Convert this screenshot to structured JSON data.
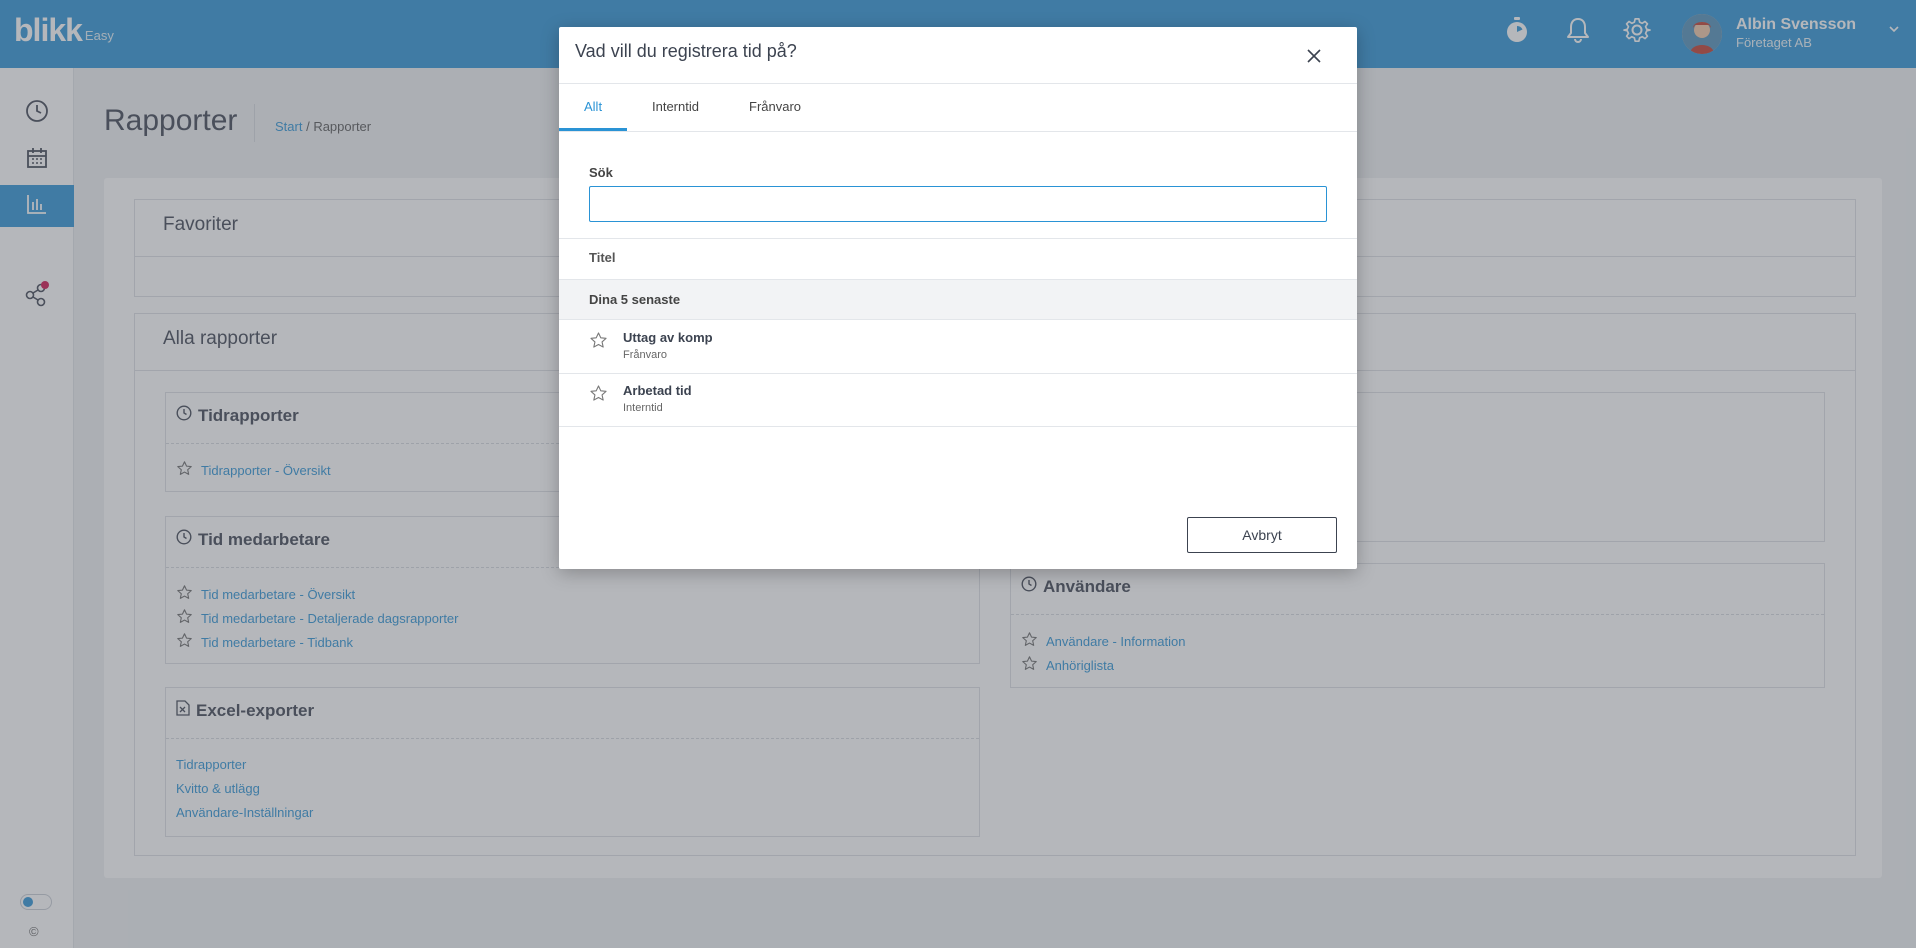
{
  "header": {
    "logo_brand": "blikk",
    "logo_edition": "Easy",
    "user_name": "Albin Svensson",
    "user_company": "Företaget AB"
  },
  "page": {
    "title": "Rapporter",
    "breadcrumb_start": "Start",
    "breadcrumb_sep": " / ",
    "breadcrumb_current": "Rapporter"
  },
  "favorites": {
    "title": "Favoriter"
  },
  "all_reports": {
    "title": "Alla rapporter",
    "time_reports": {
      "title": "Tidrapporter",
      "links": [
        "Tidrapporter - Översikt"
      ]
    },
    "employee_time": {
      "title": "Tid medarbetare",
      "links": [
        "Tid medarbetare - Översikt",
        "Tid medarbetare - Detaljerade dagsrapporter",
        "Tid medarbetare - Tidbank"
      ]
    },
    "excel_exports": {
      "title": "Excel-exporter",
      "links": [
        "Tidrapporter",
        "Kvitto & utlägg",
        "Användare-Inställningar"
      ]
    },
    "users": {
      "title": "Användare",
      "links": [
        "Användare - Information",
        "Anhöriglista"
      ]
    }
  },
  "sidebar": {
    "copyright": "©"
  },
  "modal": {
    "title": "Vad vill du registrera tid på?",
    "tabs": [
      "Allt",
      "Interntid",
      "Frånvaro"
    ],
    "search_label": "Sök",
    "search_value": "",
    "column_header": "Titel",
    "group_label": "Dina 5 senaste",
    "items": [
      {
        "title": "Uttag av komp",
        "subtitle": "Frånvaro"
      },
      {
        "title": "Arbetad tid",
        "subtitle": "Interntid"
      }
    ],
    "cancel_label": "Avbryt"
  },
  "colors": {
    "accent": "#2a93d5",
    "notification": "#d0104c"
  }
}
